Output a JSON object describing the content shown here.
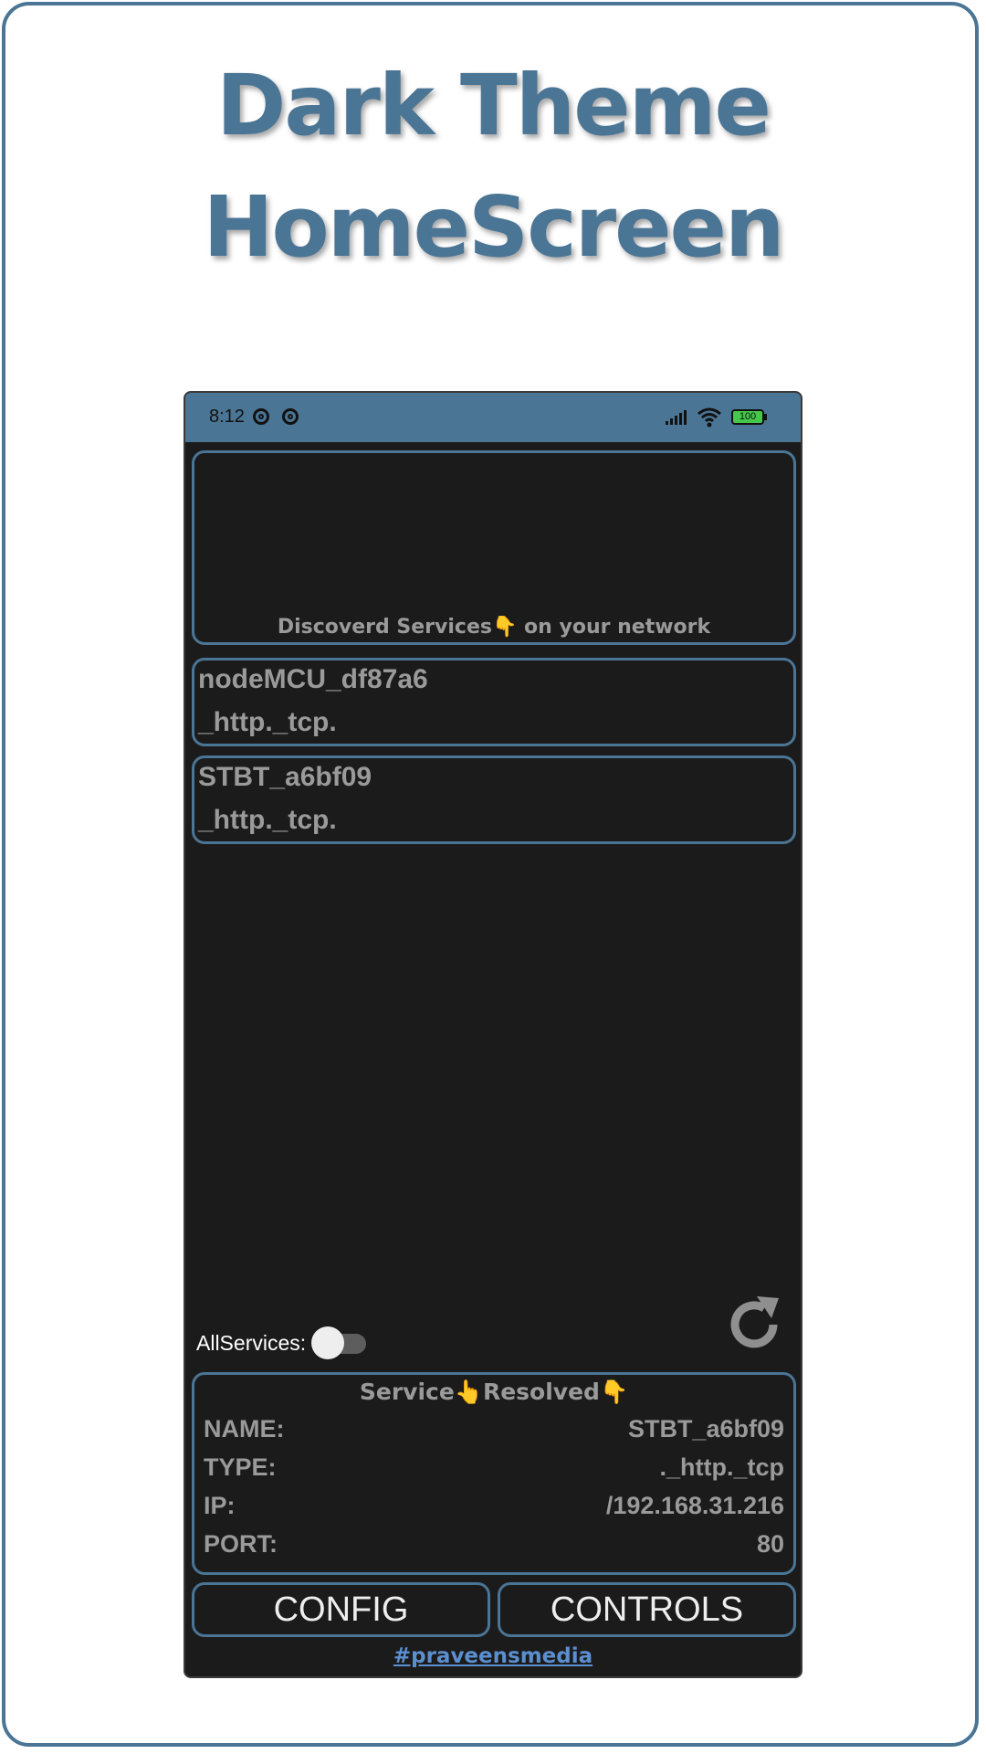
{
  "headline": {
    "line1": "Dark Theme",
    "line2": "HomeScreen"
  },
  "status_bar": {
    "time": "8:12",
    "battery": "100"
  },
  "discover": {
    "label_part1": "Discoverd Services",
    "label_part2": "on your network",
    "hand_icon": "👇"
  },
  "services": [
    {
      "name": "nodeMCU_df87a6",
      "type": "_http._tcp."
    },
    {
      "name": "STBT_a6bf09",
      "type": "_http._tcp."
    }
  ],
  "toggle": {
    "label": "AllServices:",
    "on": false
  },
  "resolved": {
    "title_part1": "Service",
    "title_part2": "Resolved",
    "point_up_icon": "👆",
    "point_down_icon": "👇",
    "rows": [
      {
        "key": "NAME:",
        "value": "STBT_a6bf09"
      },
      {
        "key": "TYPE:",
        "value": "._http._tcp"
      },
      {
        "key": "IP:",
        "value": "/192.168.31.216"
      },
      {
        "key": "PORT:",
        "value": "80"
      }
    ]
  },
  "buttons": {
    "config": "CONFIG",
    "controls": "CONTROLS"
  },
  "footer": {
    "link": "#praveensmedia"
  },
  "colors": {
    "accent": "#4b7595",
    "background": "#1b1b1b",
    "text_muted": "#9a9a9a",
    "link": "#5b8fd0",
    "hand": "#c58a1c"
  }
}
